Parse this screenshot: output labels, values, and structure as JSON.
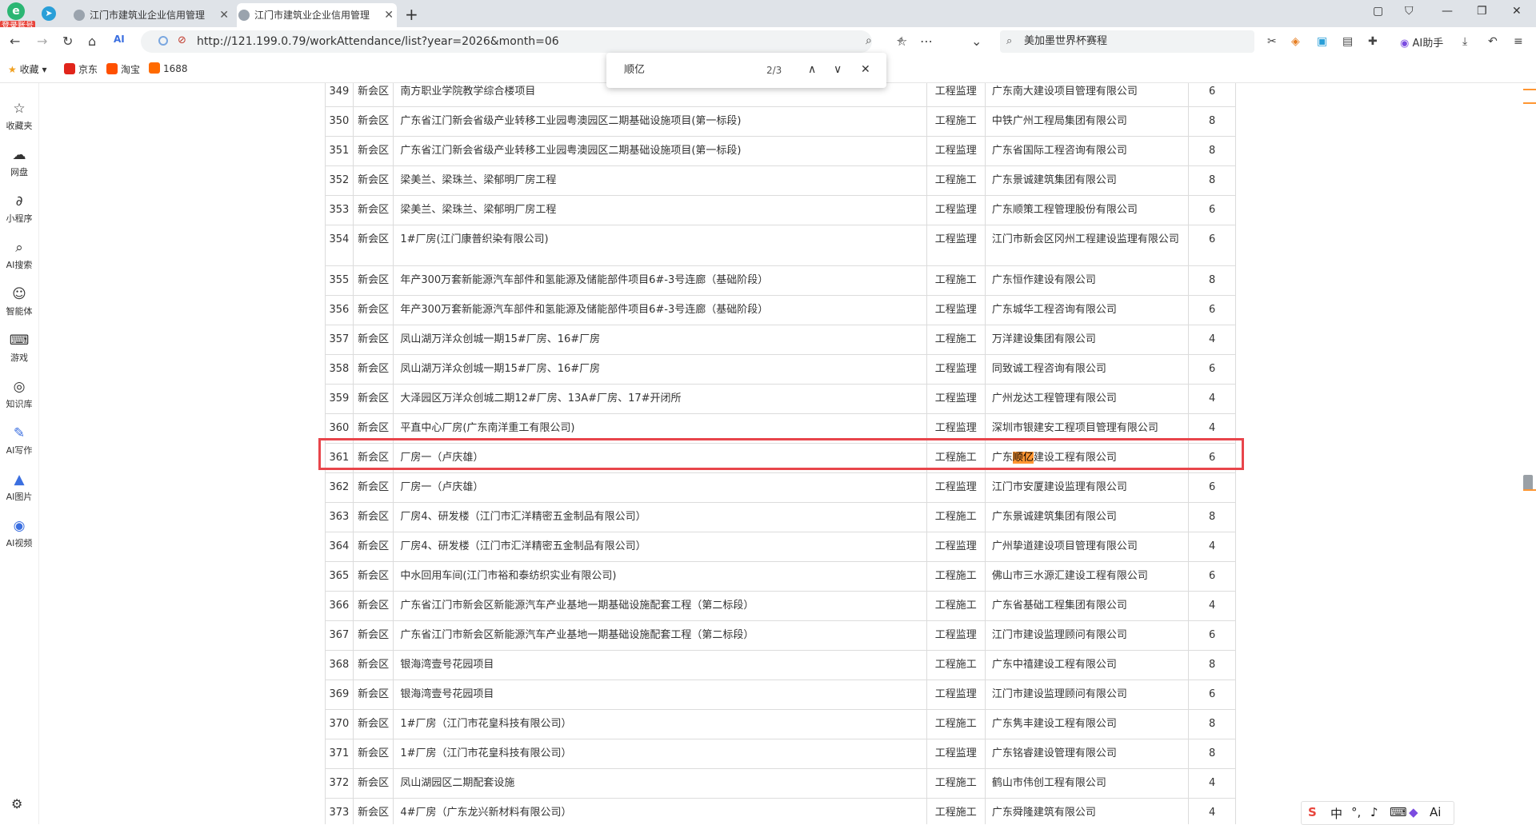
{
  "browser": {
    "logo_badge": "登录账号",
    "tabs": [
      {
        "title": "江门市建筑业企业信用管理",
        "active": false
      },
      {
        "title": "江门市建筑业企业信用管理",
        "active": true
      }
    ],
    "url": "http://121.199.0.79/workAttendance/list?year=2026&month=06",
    "search_text": "美加墨世界杯赛程",
    "ai_helper_label": "AI助手",
    "bookmarks": [
      "收藏",
      "京东",
      "淘宝",
      "1688"
    ]
  },
  "find_bar": {
    "query": "顺亿",
    "count": "2/3"
  },
  "sidebar": {
    "items": [
      "收藏夹",
      "网盘",
      "小程序",
      "AI搜索",
      "智能体",
      "游戏",
      "知识库",
      "AI写作",
      "AI图片",
      "AI视频"
    ]
  },
  "table": {
    "rows": [
      {
        "no": "349",
        "district": "新会区",
        "project": "南方职业学院教学综合楼项目",
        "type": "工程监理",
        "company": "广东南大建设项目管理有限公司",
        "score": "6"
      },
      {
        "no": "350",
        "district": "新会区",
        "project": "广东省江门新会省级产业转移工业园粤澳园区二期基础设施项目(第一标段)",
        "type": "工程施工",
        "company": "中铁广州工程局集团有限公司",
        "score": "8"
      },
      {
        "no": "351",
        "district": "新会区",
        "project": "广东省江门新会省级产业转移工业园粤澳园区二期基础设施项目(第一标段)",
        "type": "工程监理",
        "company": "广东省国际工程咨询有限公司",
        "score": "8"
      },
      {
        "no": "352",
        "district": "新会区",
        "project": "梁美兰、梁珠兰、梁郁明厂房工程",
        "type": "工程施工",
        "company": "广东景诚建筑集团有限公司",
        "score": "8"
      },
      {
        "no": "353",
        "district": "新会区",
        "project": "梁美兰、梁珠兰、梁郁明厂房工程",
        "type": "工程监理",
        "company": "广东顺策工程管理股份有限公司",
        "score": "6"
      },
      {
        "no": "354",
        "district": "新会区",
        "project": "1#厂房(江门康普织染有限公司)",
        "type": "工程监理",
        "company": "江门市新会区冈州工程建设监理有限公司",
        "score": "6"
      },
      {
        "no": "355",
        "district": "新会区",
        "project": "年产300万套新能源汽车部件和氢能源及储能部件项目6#-3号连廊（基础阶段）",
        "type": "工程施工",
        "company": "广东恒作建设有限公司",
        "score": "8"
      },
      {
        "no": "356",
        "district": "新会区",
        "project": "年产300万套新能源汽车部件和氢能源及储能部件项目6#-3号连廊（基础阶段）",
        "type": "工程监理",
        "company": "广东城华工程咨询有限公司",
        "score": "6"
      },
      {
        "no": "357",
        "district": "新会区",
        "project": "凤山湖万洋众创城一期15#厂房、16#厂房",
        "type": "工程施工",
        "company": "万洋建设集团有限公司",
        "score": "4"
      },
      {
        "no": "358",
        "district": "新会区",
        "project": "凤山湖万洋众创城一期15#厂房、16#厂房",
        "type": "工程监理",
        "company": "同致诚工程咨询有限公司",
        "score": "6"
      },
      {
        "no": "359",
        "district": "新会区",
        "project": "大泽园区万洋众创城二期12#厂房、13A#厂房、17#开闭所",
        "type": "工程监理",
        "company": "广州龙达工程管理有限公司",
        "score": "4"
      },
      {
        "no": "360",
        "district": "新会区",
        "project": "平直中心厂房(广东南洋重工有限公司)",
        "type": "工程监理",
        "company": "深圳市银建安工程项目管理有限公司",
        "score": "4"
      },
      {
        "no": "361",
        "district": "新会区",
        "project": "厂房一（卢庆雄）",
        "type": "工程施工",
        "company_pre": "广东",
        "company_hl": "顺亿",
        "company_post": "建设工程有限公司",
        "score": "6",
        "highlighted": true
      },
      {
        "no": "362",
        "district": "新会区",
        "project": "厂房一（卢庆雄）",
        "type": "工程监理",
        "company": "江门市安厦建设监理有限公司",
        "score": "6"
      },
      {
        "no": "363",
        "district": "新会区",
        "project": "厂房4、研发楼（江门市汇洋精密五金制品有限公司）",
        "type": "工程施工",
        "company": "广东景诚建筑集团有限公司",
        "score": "8"
      },
      {
        "no": "364",
        "district": "新会区",
        "project": "厂房4、研发楼（江门市汇洋精密五金制品有限公司）",
        "type": "工程监理",
        "company": "广州挚道建设项目管理有限公司",
        "score": "4"
      },
      {
        "no": "365",
        "district": "新会区",
        "project": "中水回用车间(江门市裕和泰纺织实业有限公司)",
        "type": "工程施工",
        "company": "佛山市三水源汇建设工程有限公司",
        "score": "6"
      },
      {
        "no": "366",
        "district": "新会区",
        "project": "广东省江门市新会区新能源汽车产业基地一期基础设施配套工程（第二标段）",
        "type": "工程施工",
        "company": "广东省基础工程集团有限公司",
        "score": "4"
      },
      {
        "no": "367",
        "district": "新会区",
        "project": "广东省江门市新会区新能源汽车产业基地一期基础设施配套工程（第二标段）",
        "type": "工程监理",
        "company": "江门市建设监理顾问有限公司",
        "score": "6"
      },
      {
        "no": "368",
        "district": "新会区",
        "project": "银海湾壹号花园项目",
        "type": "工程施工",
        "company": "广东中禧建设工程有限公司",
        "score": "8"
      },
      {
        "no": "369",
        "district": "新会区",
        "project": "银海湾壹号花园项目",
        "type": "工程监理",
        "company": "江门市建设监理顾问有限公司",
        "score": "6"
      },
      {
        "no": "370",
        "district": "新会区",
        "project": "1#厂房（江门市花皇科技有限公司）",
        "type": "工程施工",
        "company": "广东隽丰建设工程有限公司",
        "score": "8"
      },
      {
        "no": "371",
        "district": "新会区",
        "project": "1#厂房（江门市花皇科技有限公司）",
        "type": "工程监理",
        "company": "广东铭睿建设管理有限公司",
        "score": "8"
      },
      {
        "no": "372",
        "district": "新会区",
        "project": "凤山湖园区二期配套设施",
        "type": "工程施工",
        "company": "鹤山市伟创工程有限公司",
        "score": "4"
      },
      {
        "no": "373",
        "district": "新会区",
        "project": "4#厂房（广东龙兴新材料有限公司）",
        "type": "工程施工",
        "company": "广东舜隆建筑有限公司",
        "score": "4"
      }
    ]
  },
  "ime": {
    "chinese": "中",
    "ai": "Ai"
  }
}
